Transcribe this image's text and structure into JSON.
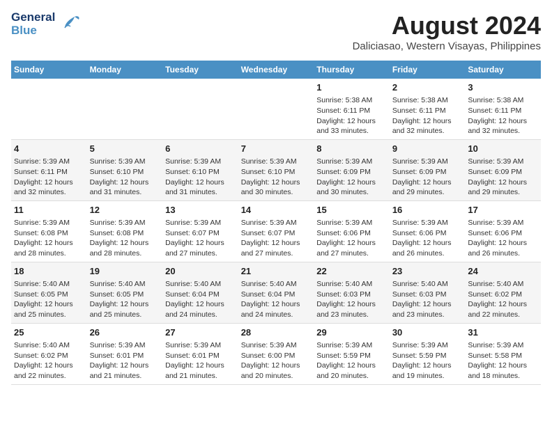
{
  "logo": {
    "line1": "General",
    "line2": "Blue"
  },
  "title": "August 2024",
  "subtitle": "Daliciasao, Western Visayas, Philippines",
  "days_of_week": [
    "Sunday",
    "Monday",
    "Tuesday",
    "Wednesday",
    "Thursday",
    "Friday",
    "Saturday"
  ],
  "weeks": [
    {
      "id": "week1",
      "cells": [
        {
          "day": "",
          "num": "",
          "text": ""
        },
        {
          "day": "",
          "num": "",
          "text": ""
        },
        {
          "day": "",
          "num": "",
          "text": ""
        },
        {
          "day": "",
          "num": "",
          "text": ""
        },
        {
          "day": "Thursday",
          "num": "1",
          "text": "Sunrise: 5:38 AM\nSunset: 6:11 PM\nDaylight: 12 hours\nand 33 minutes."
        },
        {
          "day": "Friday",
          "num": "2",
          "text": "Sunrise: 5:38 AM\nSunset: 6:11 PM\nDaylight: 12 hours\nand 32 minutes."
        },
        {
          "day": "Saturday",
          "num": "3",
          "text": "Sunrise: 5:38 AM\nSunset: 6:11 PM\nDaylight: 12 hours\nand 32 minutes."
        }
      ]
    },
    {
      "id": "week2",
      "cells": [
        {
          "day": "Sunday",
          "num": "4",
          "text": "Sunrise: 5:39 AM\nSunset: 6:11 PM\nDaylight: 12 hours\nand 32 minutes."
        },
        {
          "day": "Monday",
          "num": "5",
          "text": "Sunrise: 5:39 AM\nSunset: 6:10 PM\nDaylight: 12 hours\nand 31 minutes."
        },
        {
          "day": "Tuesday",
          "num": "6",
          "text": "Sunrise: 5:39 AM\nSunset: 6:10 PM\nDaylight: 12 hours\nand 31 minutes."
        },
        {
          "day": "Wednesday",
          "num": "7",
          "text": "Sunrise: 5:39 AM\nSunset: 6:10 PM\nDaylight: 12 hours\nand 30 minutes."
        },
        {
          "day": "Thursday",
          "num": "8",
          "text": "Sunrise: 5:39 AM\nSunset: 6:09 PM\nDaylight: 12 hours\nand 30 minutes."
        },
        {
          "day": "Friday",
          "num": "9",
          "text": "Sunrise: 5:39 AM\nSunset: 6:09 PM\nDaylight: 12 hours\nand 29 minutes."
        },
        {
          "day": "Saturday",
          "num": "10",
          "text": "Sunrise: 5:39 AM\nSunset: 6:09 PM\nDaylight: 12 hours\nand 29 minutes."
        }
      ]
    },
    {
      "id": "week3",
      "cells": [
        {
          "day": "Sunday",
          "num": "11",
          "text": "Sunrise: 5:39 AM\nSunset: 6:08 PM\nDaylight: 12 hours\nand 28 minutes."
        },
        {
          "day": "Monday",
          "num": "12",
          "text": "Sunrise: 5:39 AM\nSunset: 6:08 PM\nDaylight: 12 hours\nand 28 minutes."
        },
        {
          "day": "Tuesday",
          "num": "13",
          "text": "Sunrise: 5:39 AM\nSunset: 6:07 PM\nDaylight: 12 hours\nand 27 minutes."
        },
        {
          "day": "Wednesday",
          "num": "14",
          "text": "Sunrise: 5:39 AM\nSunset: 6:07 PM\nDaylight: 12 hours\nand 27 minutes."
        },
        {
          "day": "Thursday",
          "num": "15",
          "text": "Sunrise: 5:39 AM\nSunset: 6:06 PM\nDaylight: 12 hours\nand 27 minutes."
        },
        {
          "day": "Friday",
          "num": "16",
          "text": "Sunrise: 5:39 AM\nSunset: 6:06 PM\nDaylight: 12 hours\nand 26 minutes."
        },
        {
          "day": "Saturday",
          "num": "17",
          "text": "Sunrise: 5:39 AM\nSunset: 6:06 PM\nDaylight: 12 hours\nand 26 minutes."
        }
      ]
    },
    {
      "id": "week4",
      "cells": [
        {
          "day": "Sunday",
          "num": "18",
          "text": "Sunrise: 5:40 AM\nSunset: 6:05 PM\nDaylight: 12 hours\nand 25 minutes."
        },
        {
          "day": "Monday",
          "num": "19",
          "text": "Sunrise: 5:40 AM\nSunset: 6:05 PM\nDaylight: 12 hours\nand 25 minutes."
        },
        {
          "day": "Tuesday",
          "num": "20",
          "text": "Sunrise: 5:40 AM\nSunset: 6:04 PM\nDaylight: 12 hours\nand 24 minutes."
        },
        {
          "day": "Wednesday",
          "num": "21",
          "text": "Sunrise: 5:40 AM\nSunset: 6:04 PM\nDaylight: 12 hours\nand 24 minutes."
        },
        {
          "day": "Thursday",
          "num": "22",
          "text": "Sunrise: 5:40 AM\nSunset: 6:03 PM\nDaylight: 12 hours\nand 23 minutes."
        },
        {
          "day": "Friday",
          "num": "23",
          "text": "Sunrise: 5:40 AM\nSunset: 6:03 PM\nDaylight: 12 hours\nand 23 minutes."
        },
        {
          "day": "Saturday",
          "num": "24",
          "text": "Sunrise: 5:40 AM\nSunset: 6:02 PM\nDaylight: 12 hours\nand 22 minutes."
        }
      ]
    },
    {
      "id": "week5",
      "cells": [
        {
          "day": "Sunday",
          "num": "25",
          "text": "Sunrise: 5:40 AM\nSunset: 6:02 PM\nDaylight: 12 hours\nand 22 minutes."
        },
        {
          "day": "Monday",
          "num": "26",
          "text": "Sunrise: 5:39 AM\nSunset: 6:01 PM\nDaylight: 12 hours\nand 21 minutes."
        },
        {
          "day": "Tuesday",
          "num": "27",
          "text": "Sunrise: 5:39 AM\nSunset: 6:01 PM\nDaylight: 12 hours\nand 21 minutes."
        },
        {
          "day": "Wednesday",
          "num": "28",
          "text": "Sunrise: 5:39 AM\nSunset: 6:00 PM\nDaylight: 12 hours\nand 20 minutes."
        },
        {
          "day": "Thursday",
          "num": "29",
          "text": "Sunrise: 5:39 AM\nSunset: 5:59 PM\nDaylight: 12 hours\nand 20 minutes."
        },
        {
          "day": "Friday",
          "num": "30",
          "text": "Sunrise: 5:39 AM\nSunset: 5:59 PM\nDaylight: 12 hours\nand 19 minutes."
        },
        {
          "day": "Saturday",
          "num": "31",
          "text": "Sunrise: 5:39 AM\nSunset: 5:58 PM\nDaylight: 12 hours\nand 18 minutes."
        }
      ]
    }
  ]
}
